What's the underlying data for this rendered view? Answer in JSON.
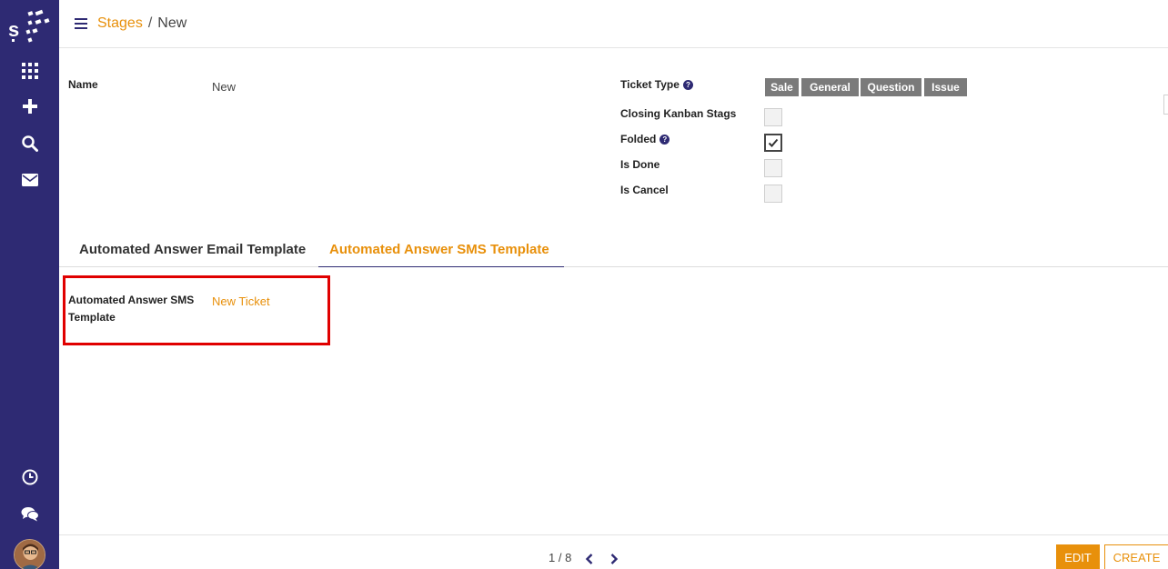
{
  "sidebar": {
    "icons": [
      "apps-icon",
      "plus-icon",
      "search-icon",
      "mail-icon",
      "clock-icon",
      "chat-icon"
    ],
    "brand_color": "#2e2a73"
  },
  "header": {
    "breadcrumb_parent": "Stages",
    "breadcrumb_separator": "/",
    "breadcrumb_current": "New"
  },
  "form": {
    "name_label": "Name",
    "name_value": "New",
    "ticket_type_label": "Ticket Type",
    "ticket_types": [
      "Sale",
      "General",
      "Question",
      "Issue"
    ],
    "closing_kanban_label": "Closing Kanban Stags",
    "closing_kanban_checked": false,
    "folded_label": "Folded",
    "folded_checked": true,
    "is_done_label": "Is Done",
    "is_done_checked": false,
    "is_cancel_label": "Is Cancel",
    "is_cancel_checked": false,
    "help_glyph": "?"
  },
  "tabs": {
    "email": "Automated Answer Email Template",
    "sms": "Automated Answer SMS Template",
    "active": "sms"
  },
  "sms_tab": {
    "label": "Automated Answer SMS Template",
    "value": "New Ticket"
  },
  "footer": {
    "pager": "1 / 8",
    "edit": "EDIT",
    "create": "CREATE"
  },
  "colors": {
    "accent": "#e8900b",
    "highlight": "#e00000",
    "tag": "#7a7a7a"
  }
}
